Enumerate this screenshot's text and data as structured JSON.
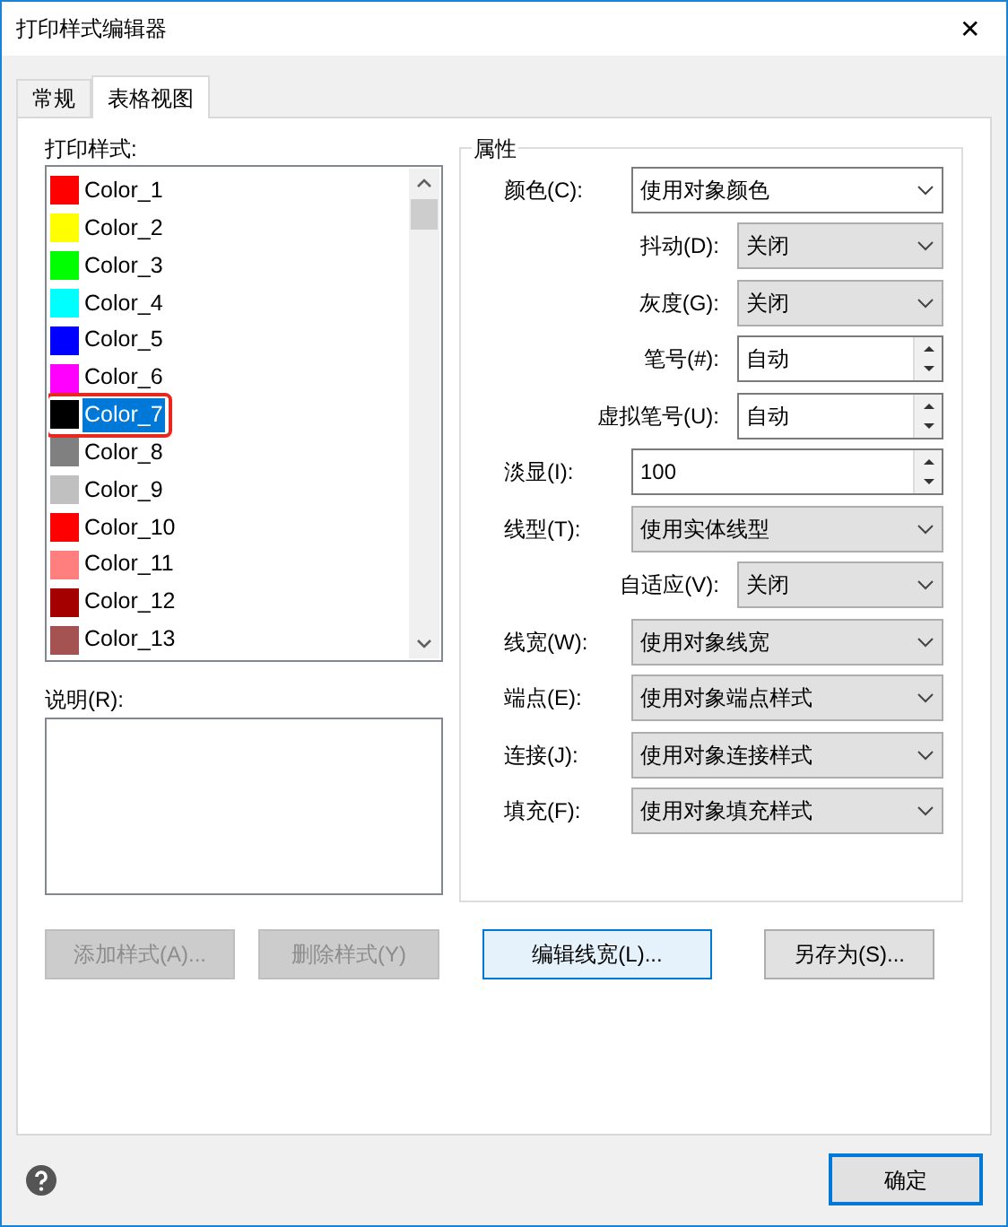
{
  "window": {
    "title": "打印样式编辑器",
    "close": "✕"
  },
  "tabs": [
    {
      "label": "常规",
      "selected": false
    },
    {
      "label": "表格视图",
      "selected": true
    }
  ],
  "styles_label": "打印样式:",
  "styles": [
    {
      "name": "Color_1",
      "color": "#ff0000",
      "selected": false,
      "outlined": false
    },
    {
      "name": "Color_2",
      "color": "#ffff00",
      "selected": false,
      "outlined": false
    },
    {
      "name": "Color_3",
      "color": "#00ff00",
      "selected": false,
      "outlined": false
    },
    {
      "name": "Color_4",
      "color": "#00ffff",
      "selected": false,
      "outlined": false
    },
    {
      "name": "Color_5",
      "color": "#0000ff",
      "selected": false,
      "outlined": false
    },
    {
      "name": "Color_6",
      "color": "#ff00ff",
      "selected": false,
      "outlined": false
    },
    {
      "name": "Color_7",
      "color": "#000000",
      "selected": true,
      "outlined": true
    },
    {
      "name": "Color_8",
      "color": "#808080",
      "selected": false,
      "outlined": false
    },
    {
      "name": "Color_9",
      "color": "#c0c0c0",
      "selected": false,
      "outlined": false
    },
    {
      "name": "Color_10",
      "color": "#ff0000",
      "selected": false,
      "outlined": false
    },
    {
      "name": "Color_11",
      "color": "#ff7f7f",
      "selected": false,
      "outlined": false
    },
    {
      "name": "Color_12",
      "color": "#a50000",
      "selected": false,
      "outlined": false
    },
    {
      "name": "Color_13",
      "color": "#a55252",
      "selected": false,
      "outlined": false
    }
  ],
  "description_label": "说明(R):",
  "properties": {
    "title": "属性",
    "rows": [
      {
        "label": "颜色(C):",
        "kind": "combo",
        "value": "使用对象颜色",
        "editable": true,
        "indented": false
      },
      {
        "label": "抖动(D):",
        "kind": "combo",
        "value": "关闭",
        "editable": false,
        "indented": true
      },
      {
        "label": "灰度(G):",
        "kind": "combo",
        "value": "关闭",
        "editable": false,
        "indented": true
      },
      {
        "label": "笔号(#):",
        "kind": "spin",
        "value": "自动",
        "indented": true
      },
      {
        "label": "虚拟笔号(U):",
        "kind": "spin",
        "value": "自动",
        "indented": true
      },
      {
        "label": "淡显(I):",
        "kind": "spin",
        "value": "100",
        "indented": false
      },
      {
        "label": "线型(T):",
        "kind": "combo",
        "value": "使用实体线型",
        "editable": false,
        "indented": false
      },
      {
        "label": "自适应(V):",
        "kind": "combo",
        "value": "关闭",
        "editable": false,
        "indented": true
      },
      {
        "label": "线宽(W):",
        "kind": "combo",
        "value": "使用对象线宽",
        "editable": false,
        "indented": false
      },
      {
        "label": "端点(E):",
        "kind": "combo",
        "value": "使用对象端点样式",
        "editable": false,
        "indented": false
      },
      {
        "label": "连接(J):",
        "kind": "combo",
        "value": "使用对象连接样式",
        "editable": false,
        "indented": false
      },
      {
        "label": "填充(F):",
        "kind": "combo",
        "value": "使用对象填充样式",
        "editable": false,
        "indented": false
      }
    ]
  },
  "buttons": [
    {
      "label": "添加样式(A)...",
      "disabled": true,
      "focused": false
    },
    {
      "label": "删除样式(Y)",
      "disabled": true,
      "focused": false
    },
    {
      "label": "编辑线宽(L)...",
      "disabled": false,
      "focused": true
    },
    {
      "label": "另存为(S)...",
      "disabled": false,
      "focused": false
    }
  ],
  "ok_button": "确定"
}
